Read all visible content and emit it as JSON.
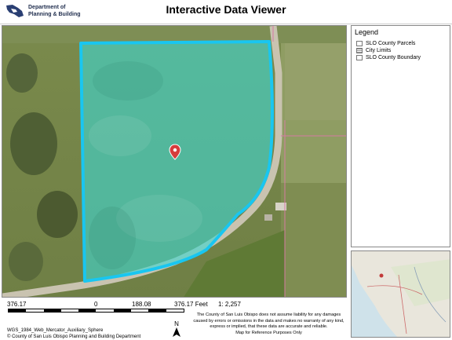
{
  "header": {
    "department_line1": "Department of",
    "department_line2": "Planning & Building",
    "title": "Interactive Data Viewer"
  },
  "legend": {
    "title": "Legend",
    "items": [
      {
        "label": "SLO County Parcels",
        "swatch": "outline"
      },
      {
        "label": "City Limits",
        "swatch": "hatched"
      },
      {
        "label": "SLO County Boundary",
        "swatch": "outline"
      }
    ]
  },
  "map": {
    "parcel_fill_color": "#3fd6d0",
    "parcel_outline_color": "#19c6f0",
    "marker_color": "#d63c3c"
  },
  "scale": {
    "labels": [
      "376.17",
      "0",
      "188.08",
      "376.17 Feet"
    ],
    "ratio": "1: 2,257"
  },
  "footer": {
    "projection": "WGS_1984_Web_Mercator_Auxiliary_Sphere",
    "copyright": "© County of San Luis Obispo Planning and Building Department",
    "north_label": "N",
    "disclaimer_lines": [
      "The County of San Luis Obispo does not assume liability for any damages",
      "caused by errors or omissions in the data and makes no warranty of any kind,",
      "express or implied, that these data are accurate and reliable.",
      "Map for Reference Purposes Only"
    ]
  }
}
